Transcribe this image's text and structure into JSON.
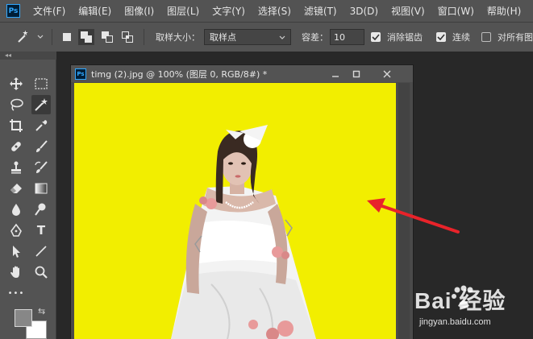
{
  "app": {
    "logo_text": "Ps",
    "menus": [
      "文件(F)",
      "编辑(E)",
      "图像(I)",
      "图层(L)",
      "文字(Y)",
      "选择(S)",
      "滤镜(T)",
      "3D(D)",
      "视图(V)",
      "窗口(W)",
      "帮助(H)"
    ]
  },
  "options": {
    "sample_size_label": "取样大小：",
    "sample_size_value": "取样点",
    "tolerance_label": "容差：",
    "tolerance_value": "10",
    "antialias_label": "消除锯齿",
    "antialias_checked": true,
    "contiguous_label": "连续",
    "contiguous_checked": true,
    "sample_all_label": "对所有图",
    "sample_all_checked": false
  },
  "toolbar": {
    "collapse_glyph": "◂◂",
    "type_tool_glyph": "T",
    "more_glyph": "•••"
  },
  "document": {
    "icon_text": "Ps",
    "title": "timg (2).jpg @ 100% (图层 0, RGB/8#) *",
    "canvas_color": "#f2ee00"
  },
  "colors": {
    "foreground": "#878787",
    "background": "#ffffff",
    "annotation_arrow": "#e8232a"
  },
  "watermark": {
    "brand": "Bai 经验",
    "url": "jingyan.baidu.com"
  }
}
